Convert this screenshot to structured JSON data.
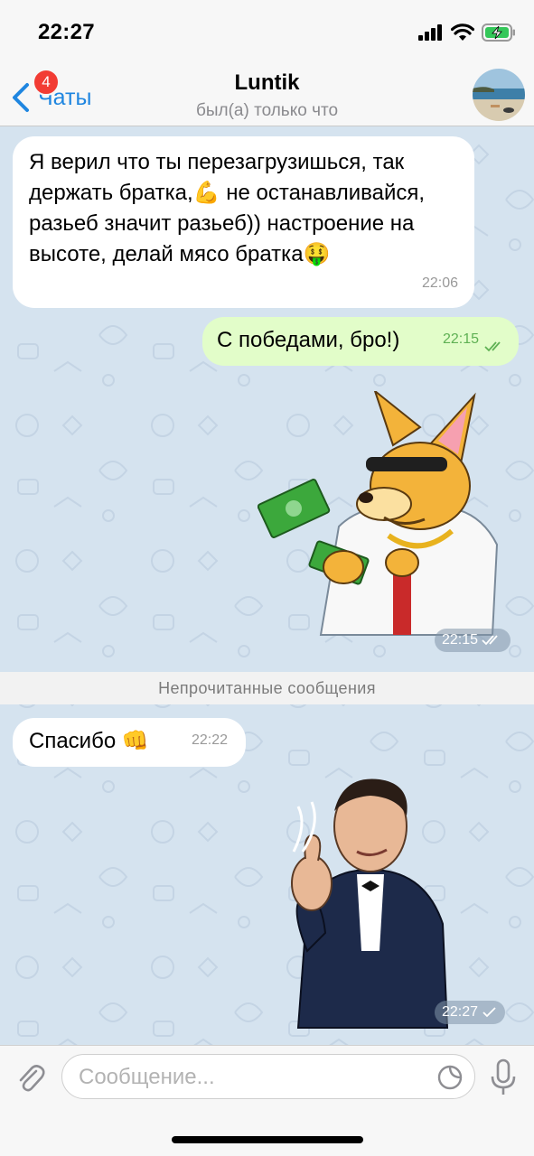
{
  "status_bar": {
    "time": "22:27",
    "icons": [
      "signal-icon",
      "wifi-icon",
      "battery-charging-icon"
    ]
  },
  "header": {
    "back_label": "Чаты",
    "unread_badge": "4",
    "title": "Luntik",
    "subtitle": "был(а) только что",
    "avatar_icon": "beach-avatar"
  },
  "messages": [
    {
      "direction": "incoming",
      "text": "Я верил что ты перезагрузишься, так держать братка,💪 не останавливайся, разьеб значит разьеб)) настроение на высоте, делай мясо братка🤑",
      "time": "22:06"
    },
    {
      "direction": "outgoing",
      "text": "С победами, бро!)",
      "time": "22:15",
      "status": "read"
    },
    {
      "direction": "outgoing",
      "type": "sticker",
      "sticker": "kangaroo-money-sticker",
      "time": "22:15",
      "status": "read"
    },
    {
      "direction": "incoming",
      "text": "Спасибо 👊",
      "time": "22:22"
    },
    {
      "direction": "outgoing",
      "type": "sticker",
      "sticker": "gentleman-thumbs-up-sticker",
      "time": "22:27",
      "status": "sent"
    }
  ],
  "unread_divider": "Непрочитанные сообщения",
  "input": {
    "placeholder": "Сообщение...",
    "value": ""
  },
  "colors": {
    "accent": "#1f86e0",
    "badge": "#f23c34",
    "outgoing_bubble": "#e2fdc9",
    "incoming_bubble": "#ffffff",
    "wallpaper": "#d5e3ef"
  }
}
